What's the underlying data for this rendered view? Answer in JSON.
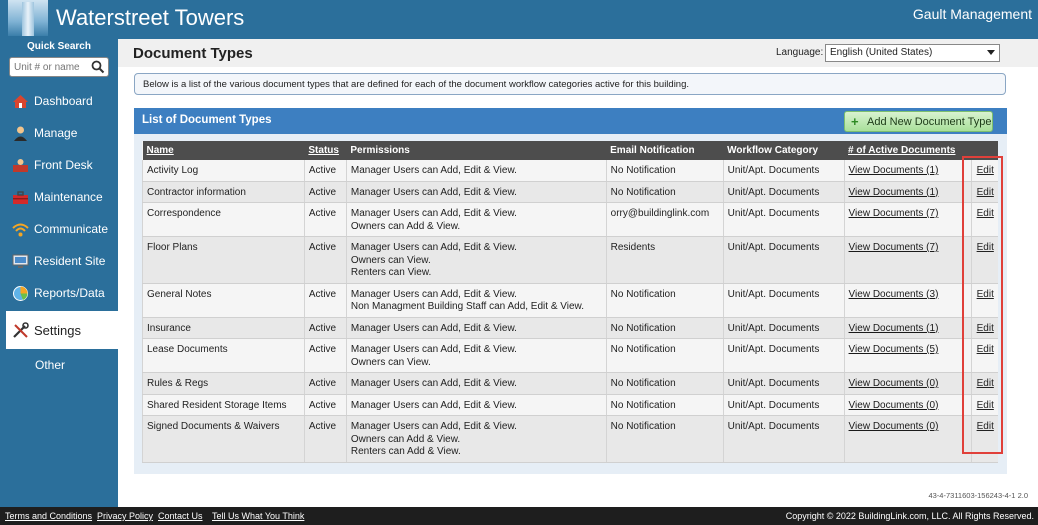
{
  "header": {
    "app_title": "Waterstreet Towers",
    "company": "Gault Management"
  },
  "sidebar": {
    "quick_search_label": "Quick Search",
    "quick_search_placeholder": "Unit # or name",
    "items": [
      {
        "label": "Dashboard",
        "icon": "house-icon"
      },
      {
        "label": "Manage",
        "icon": "person-icon"
      },
      {
        "label": "Front Desk",
        "icon": "front-desk-icon"
      },
      {
        "label": "Maintenance",
        "icon": "toolbox-icon"
      },
      {
        "label": "Communicate",
        "icon": "wifi-icon"
      },
      {
        "label": "Resident Site",
        "icon": "monitor-icon"
      },
      {
        "label": "Reports/Data",
        "icon": "pie-chart-icon"
      },
      {
        "label": "Settings",
        "icon": "tools-icon"
      },
      {
        "label": "Other",
        "icon": ""
      }
    ]
  },
  "page": {
    "title": "Document Types",
    "language_label": "Language:",
    "language_value": "English (United States)",
    "info_text": "Below is a list of the various document types that are defined for each of the document workflow categories active for this building."
  },
  "panel": {
    "title": "List of Document Types",
    "add_button": "Add New Document Type"
  },
  "table": {
    "headers": [
      "Name",
      "Status",
      "Permissions",
      "Email Notification",
      "Workflow Category",
      "# of Active Documents",
      ""
    ],
    "rows": [
      {
        "name": "Activity Log",
        "status": "Active",
        "permissions": [
          "Manager Users can Add, Edit & View."
        ],
        "email": "No Notification",
        "category": "Unit/Apt. Documents",
        "docs": "View Documents (1)",
        "edit": "Edit"
      },
      {
        "name": "Contractor information",
        "status": "Active",
        "permissions": [
          "Manager Users can Add, Edit & View."
        ],
        "email": "No Notification",
        "category": "Unit/Apt. Documents",
        "docs": "View Documents (1)",
        "edit": "Edit"
      },
      {
        "name": "Correspondence",
        "status": "Active",
        "permissions": [
          "Manager Users can Add, Edit & View.",
          "Owners can Add & View."
        ],
        "email": "orry@buildinglink.com",
        "category": "Unit/Apt. Documents",
        "docs": "View Documents (7)",
        "edit": "Edit"
      },
      {
        "name": "Floor Plans",
        "status": "Active",
        "permissions": [
          "Manager Users can Add, Edit & View.",
          "Owners can View.",
          "Renters can View."
        ],
        "email": "Residents",
        "category": "Unit/Apt. Documents",
        "docs": "View Documents (7)",
        "edit": "Edit"
      },
      {
        "name": "General Notes",
        "status": "Active",
        "permissions": [
          "Manager Users can Add, Edit & View.",
          "Non Managment Building Staff can Add, Edit & View."
        ],
        "email": "No Notification",
        "category": "Unit/Apt. Documents",
        "docs": "View Documents (3)",
        "edit": "Edit"
      },
      {
        "name": "Insurance",
        "status": "Active",
        "permissions": [
          "Manager Users can Add, Edit & View."
        ],
        "email": "No Notification",
        "category": "Unit/Apt. Documents",
        "docs": "View Documents (1)",
        "edit": "Edit"
      },
      {
        "name": "Lease Documents",
        "status": "Active",
        "permissions": [
          "Manager Users can Add, Edit & View.",
          "Owners can View."
        ],
        "email": "No Notification",
        "category": "Unit/Apt. Documents",
        "docs": "View Documents (5)",
        "edit": "Edit"
      },
      {
        "name": "Rules & Regs",
        "status": "Active",
        "permissions": [
          "Manager Users can Add, Edit & View."
        ],
        "email": "No Notification",
        "category": "Unit/Apt. Documents",
        "docs": "View Documents (0)",
        "edit": "Edit"
      },
      {
        "name": "Shared Resident Storage Items",
        "status": "Active",
        "permissions": [
          "Manager Users can Add, Edit & View."
        ],
        "email": "No Notification",
        "category": "Unit/Apt. Documents",
        "docs": "View Documents (0)",
        "edit": "Edit"
      },
      {
        "name": "Signed Documents & Waivers",
        "status": "Active",
        "permissions": [
          "Manager Users can Add, Edit & View.",
          "Owners can Add & View.",
          "Renters can Add & View."
        ],
        "email": "No Notification",
        "category": "Unit/Apt. Documents",
        "docs": "View Documents (0)",
        "edit": "Edit"
      }
    ]
  },
  "version": "43-4-7311603-156243-4-1 2.0",
  "footer": {
    "links": [
      "Terms and Conditions",
      "Privacy Policy",
      "Contact Us",
      "Tell Us What You Think"
    ],
    "copyright": "Copyright © 2022 BuildingLink.com, LLC.  All Rights Reserved."
  },
  "colors": {
    "brand": "#2b6f9b",
    "panel_header": "#3d7fc1",
    "table_header": "#4d4d4d",
    "highlight": "#e0403a",
    "add_button": "#a8e09a"
  }
}
